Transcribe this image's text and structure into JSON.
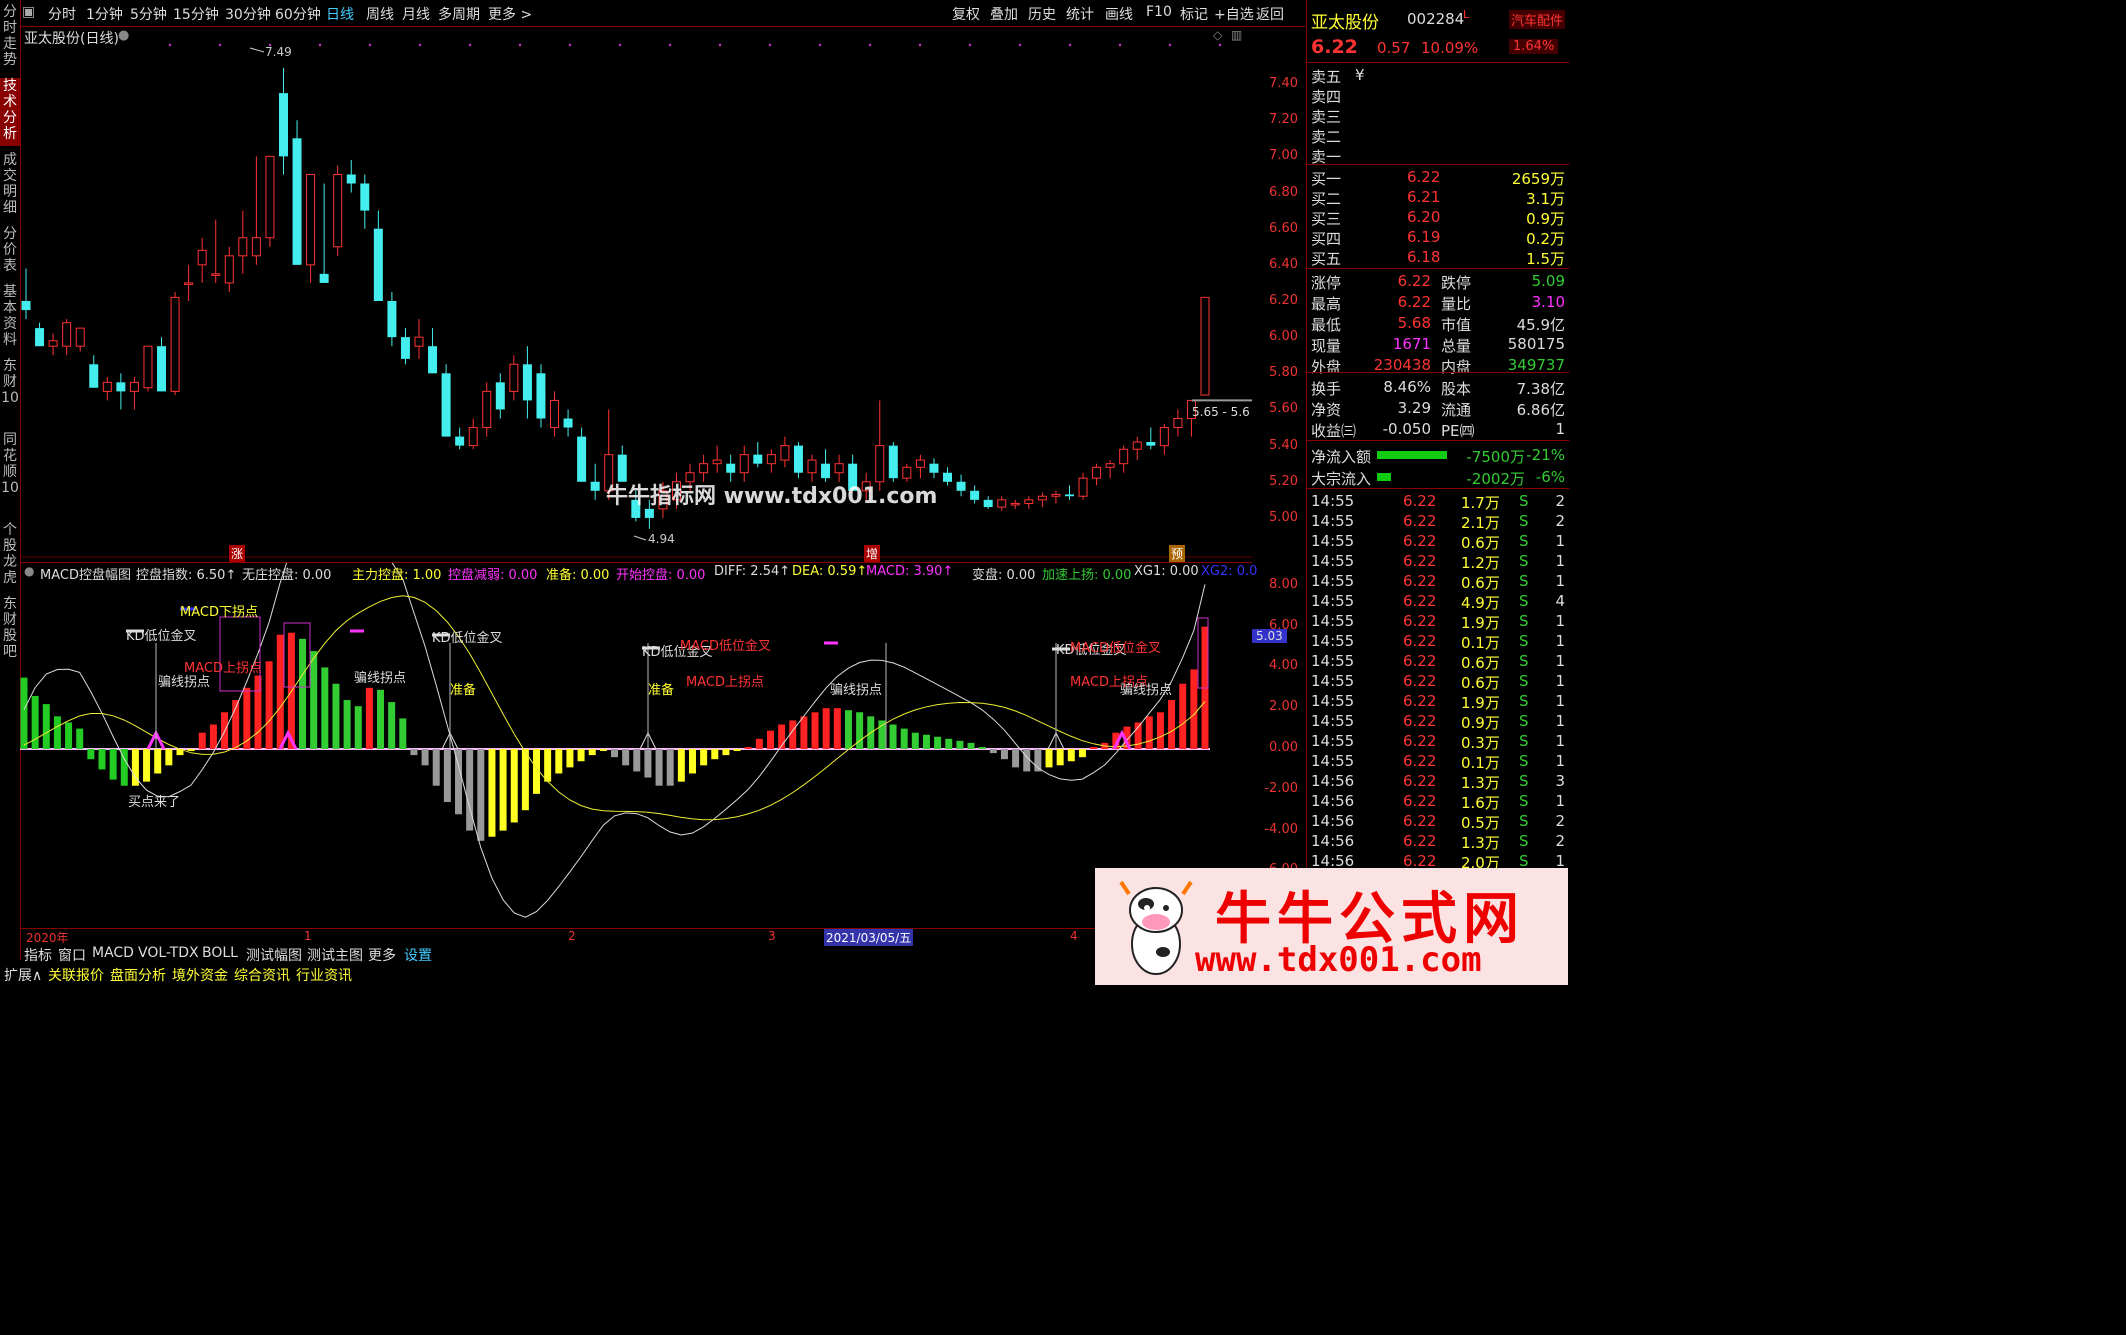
{
  "toolbar": {
    "periods": [
      "分时",
      "1分钟",
      "5分钟",
      "15分钟",
      "30分钟",
      "60分钟",
      "日线",
      "周线",
      "月线",
      "多周期",
      "更多 >"
    ],
    "selected": "日线",
    "actions": [
      "复权",
      "叠加",
      "历史",
      "统计",
      "画线",
      "F10",
      "标记",
      "+自选",
      "返回"
    ]
  },
  "left_tabs": [
    "分时走势",
    "技术分析",
    "成交明细",
    "分价表",
    "基本资料",
    "东财10",
    "同花顺10",
    "个股龙虎",
    "东财股吧"
  ],
  "left_tab_selected": "技术分析",
  "chart": {
    "title": "亚太股份(日线)",
    "high_label": "7.49",
    "low_label": "4.94",
    "price_axis": [
      "7.40",
      "7.20",
      "7.00",
      "6.80",
      "6.60",
      "6.40",
      "6.20",
      "6.00",
      "5.80",
      "5.60",
      "5.40",
      "5.20",
      "5.00"
    ],
    "price_tag": "5.65 - 5.6",
    "markers": [
      "涨",
      "增",
      "预"
    ],
    "watermark": "牛牛指标网 www.tdx001.com"
  },
  "indicator": {
    "name": "MACD控盘幅图",
    "fields": [
      {
        "label": "控盘指数: 6.50↑",
        "color": "#ddd"
      },
      {
        "label": "无庄控盘: 0.00",
        "color": "#ddd"
      },
      {
        "label": "主力控盘: 1.00",
        "color": "#ff3"
      },
      {
        "label": "控盘减弱: 0.00",
        "color": "#f3f"
      },
      {
        "label": "准备: 0.00",
        "color": "#ff3"
      },
      {
        "label": "开始控盘: 0.00",
        "color": "#f3f"
      },
      {
        "label": "DIFF: 2.54↑",
        "color": "#ddd"
      },
      {
        "label": "DEA: 0.59↑",
        "color": "#ff3"
      },
      {
        "label": "MACD: 3.90↑",
        "color": "#f3f"
      },
      {
        "label": "变盘: 0.00",
        "color": "#ddd"
      },
      {
        "label": "加速上扬: 0.00",
        "color": "#3c3"
      },
      {
        "label": "XG1: 0.00",
        "color": "#ddd"
      },
      {
        "label": "XG2: 0.0",
        "color": "#33f"
      }
    ],
    "axis": [
      "8.00",
      "6.00",
      "4.00",
      "2.00",
      "0.00",
      "-2.00",
      "-4.00",
      "-6.00"
    ],
    "value_tag": "5.03",
    "annotations": [
      {
        "text": "MACD下拐点",
        "color": "#ff3"
      },
      {
        "text": "KD低位金叉",
        "color": "#ddd"
      },
      {
        "text": "MACD上拐点",
        "color": "#f33"
      },
      {
        "text": "骗线拐点",
        "color": "#ddd"
      },
      {
        "text": "买点来了",
        "color": "#ddd"
      },
      {
        "text": "骗线拐点",
        "color": "#ddd"
      },
      {
        "text": "KD低位金叉",
        "color": "#ddd"
      },
      {
        "text": "准备",
        "color": "#ff3"
      },
      {
        "text": "KD低位金叉",
        "color": "#ddd"
      },
      {
        "text": "MACD低位金叉",
        "color": "#f33"
      },
      {
        "text": "准备",
        "color": "#ff3"
      },
      {
        "text": "MACD上拐点",
        "color": "#f33"
      },
      {
        "text": "骗线拐点",
        "color": "#ddd"
      },
      {
        "text": "KD低位金叉",
        "color": "#ddd"
      },
      {
        "text": "MACD低位金叉",
        "color": "#f33"
      },
      {
        "text": "MACD上拐点",
        "color": "#f33"
      },
      {
        "text": "骗线拐点",
        "color": "#ddd"
      }
    ]
  },
  "time_axis": [
    "2020年",
    "1",
    "2",
    "3",
    "2021/03/05/五",
    "4"
  ],
  "bottom_tabs": [
    "指标",
    "窗口",
    "MACD",
    "VOL-TDX",
    "BOLL",
    "测试幅图",
    "测试主图",
    "更多",
    "设置"
  ],
  "bottom_tabs2": [
    "扩展∧",
    "关联报价",
    "盘面分析",
    "境外资金",
    "综合资讯",
    "行业资讯"
  ],
  "quote": {
    "name": "亚太股份",
    "code": "002284",
    "flag": "L",
    "sector": "汽车配件",
    "sector_change": "1.64%",
    "price": "6.22",
    "change": "0.57",
    "change_pct": "10.09%",
    "asks": [
      {
        "label": "卖五",
        "price": "¥",
        "vol": ""
      },
      {
        "label": "卖四",
        "price": "",
        "vol": ""
      },
      {
        "label": "卖三",
        "price": "",
        "vol": ""
      },
      {
        "label": "卖二",
        "price": "",
        "vol": ""
      },
      {
        "label": "卖一",
        "price": "",
        "vol": ""
      }
    ],
    "bids": [
      {
        "label": "买一",
        "price": "6.22",
        "vol": "2659万"
      },
      {
        "label": "买二",
        "price": "6.21",
        "vol": "3.1万"
      },
      {
        "label": "买三",
        "price": "6.20",
        "vol": "0.9万"
      },
      {
        "label": "买四",
        "price": "6.19",
        "vol": "0.2万"
      },
      {
        "label": "买五",
        "price": "6.18",
        "vol": "1.5万"
      }
    ],
    "stats": [
      {
        "l1": "涨停",
        "v1": "6.22",
        "l2": "跌停",
        "v2": "5.09",
        "c1": "#f33",
        "c2": "#3c3"
      },
      {
        "l1": "最高",
        "v1": "6.22",
        "l2": "量比",
        "v2": "3.10",
        "c1": "#f33",
        "c2": "#f3f"
      },
      {
        "l1": "最低",
        "v1": "5.68",
        "l2": "市值",
        "v2": "45.9亿",
        "c1": "#f33",
        "c2": "#ddd"
      },
      {
        "l1": "现量",
        "v1": "1671",
        "l2": "总量",
        "v2": "580175",
        "c1": "#f3f",
        "c2": "#ddd"
      },
      {
        "l1": "外盘",
        "v1": "230438",
        "l2": "内盘",
        "v2": "349737",
        "c1": "#f33",
        "c2": "#3c3"
      }
    ],
    "stats2": [
      {
        "l1": "换手",
        "v1": "8.46%",
        "l2": "股本",
        "v2": "7.38亿"
      },
      {
        "l1": "净资",
        "v1": "3.29",
        "l2": "流通",
        "v2": "6.86亿"
      },
      {
        "l1": "收益㈢",
        "v1": "-0.050",
        "l2": "PE㈣",
        "v2": "1"
      }
    ],
    "flows": [
      {
        "label": "净流入额",
        "value": "-7500万",
        "pct": "-21%"
      },
      {
        "label": "大宗流入",
        "value": "-2002万",
        "pct": "-6%"
      }
    ],
    "ticks": [
      {
        "t": "14:55",
        "p": "6.22",
        "v": "1.7万",
        "s": "S",
        "n": "2"
      },
      {
        "t": "14:55",
        "p": "6.22",
        "v": "2.1万",
        "s": "S",
        "n": "2"
      },
      {
        "t": "14:55",
        "p": "6.22",
        "v": "0.6万",
        "s": "S",
        "n": "1"
      },
      {
        "t": "14:55",
        "p": "6.22",
        "v": "1.2万",
        "s": "S",
        "n": "1"
      },
      {
        "t": "14:55",
        "p": "6.22",
        "v": "0.6万",
        "s": "S",
        "n": "1"
      },
      {
        "t": "14:55",
        "p": "6.22",
        "v": "4.9万",
        "s": "S",
        "n": "4"
      },
      {
        "t": "14:55",
        "p": "6.22",
        "v": "1.9万",
        "s": "S",
        "n": "1"
      },
      {
        "t": "14:55",
        "p": "6.22",
        "v": "0.1万",
        "s": "S",
        "n": "1"
      },
      {
        "t": "14:55",
        "p": "6.22",
        "v": "0.6万",
        "s": "S",
        "n": "1"
      },
      {
        "t": "14:55",
        "p": "6.22",
        "v": "0.6万",
        "s": "S",
        "n": "1"
      },
      {
        "t": "14:55",
        "p": "6.22",
        "v": "1.9万",
        "s": "S",
        "n": "1"
      },
      {
        "t": "14:55",
        "p": "6.22",
        "v": "0.9万",
        "s": "S",
        "n": "1"
      },
      {
        "t": "14:55",
        "p": "6.22",
        "v": "0.3万",
        "s": "S",
        "n": "1"
      },
      {
        "t": "14:55",
        "p": "6.22",
        "v": "0.1万",
        "s": "S",
        "n": "1"
      },
      {
        "t": "14:56",
        "p": "6.22",
        "v": "1.3万",
        "s": "S",
        "n": "3"
      },
      {
        "t": "14:56",
        "p": "6.22",
        "v": "1.6万",
        "s": "S",
        "n": "1"
      },
      {
        "t": "14:56",
        "p": "6.22",
        "v": "0.5万",
        "s": "S",
        "n": "2"
      },
      {
        "t": "14:56",
        "p": "6.22",
        "v": "1.3万",
        "s": "S",
        "n": "2"
      },
      {
        "t": "14:56",
        "p": "6.22",
        "v": "2.0万",
        "s": "S",
        "n": "1"
      }
    ]
  },
  "brand": {
    "title": "牛牛公式网",
    "url": "www.tdx001.com"
  },
  "chart_data": {
    "type": "candlestick",
    "ylim": [
      4.9,
      7.5
    ],
    "candles": [
      [
        6.2,
        6.38,
        6.1,
        6.15
      ],
      [
        6.05,
        6.08,
        5.95,
        5.95
      ],
      [
        5.95,
        6.02,
        5.9,
        5.98
      ],
      [
        5.95,
        6.1,
        5.9,
        6.08
      ],
      [
        5.95,
        6.05,
        5.92,
        6.05
      ],
      [
        5.85,
        5.9,
        5.72,
        5.72
      ],
      [
        5.7,
        5.78,
        5.65,
        5.75
      ],
      [
        5.75,
        5.8,
        5.6,
        5.7
      ],
      [
        5.7,
        5.78,
        5.6,
        5.75
      ],
      [
        5.72,
        5.95,
        5.7,
        5.95
      ],
      [
        5.95,
        6.0,
        5.7,
        5.7
      ],
      [
        5.7,
        6.25,
        5.68,
        6.22
      ],
      [
        6.3,
        6.4,
        6.2,
        6.3
      ],
      [
        6.4,
        6.55,
        6.3,
        6.48
      ],
      [
        6.35,
        6.65,
        6.3,
        6.35
      ],
      [
        6.3,
        6.5,
        6.25,
        6.45
      ],
      [
        6.45,
        6.7,
        6.35,
        6.55
      ],
      [
        6.45,
        7.0,
        6.4,
        6.55
      ],
      [
        6.55,
        7.0,
        6.5,
        7.0
      ],
      [
        7.35,
        7.49,
        6.9,
        7.0
      ],
      [
        7.1,
        7.2,
        6.4,
        6.4
      ],
      [
        6.4,
        6.9,
        6.3,
        6.9
      ],
      [
        6.35,
        6.85,
        6.3,
        6.3
      ],
      [
        6.5,
        6.95,
        6.45,
        6.9
      ],
      [
        6.9,
        6.98,
        6.8,
        6.85
      ],
      [
        6.85,
        6.9,
        6.6,
        6.7
      ],
      [
        6.6,
        6.7,
        6.25,
        6.2
      ],
      [
        6.2,
        6.25,
        5.95,
        6.0
      ],
      [
        6.0,
        6.05,
        5.85,
        5.88
      ],
      [
        5.95,
        6.1,
        5.88,
        6.0
      ],
      [
        5.95,
        6.05,
        5.8,
        5.8
      ],
      [
        5.8,
        5.85,
        5.45,
        5.45
      ],
      [
        5.45,
        5.5,
        5.38,
        5.4
      ],
      [
        5.4,
        5.55,
        5.38,
        5.5
      ],
      [
        5.5,
        5.75,
        5.45,
        5.7
      ],
      [
        5.75,
        5.8,
        5.55,
        5.6
      ],
      [
        5.7,
        5.9,
        5.65,
        5.85
      ],
      [
        5.85,
        5.95,
        5.55,
        5.65
      ],
      [
        5.8,
        5.85,
        5.5,
        5.55
      ],
      [
        5.5,
        5.7,
        5.45,
        5.65
      ],
      [
        5.55,
        5.6,
        5.45,
        5.5
      ],
      [
        5.45,
        5.5,
        5.2,
        5.2
      ],
      [
        5.2,
        5.3,
        5.1,
        5.15
      ],
      [
        5.15,
        5.6,
        5.1,
        5.35
      ],
      [
        5.35,
        5.4,
        5.2,
        5.2
      ],
      [
        5.1,
        5.15,
        4.98,
        5.0
      ],
      [
        5.05,
        5.1,
        4.94,
        5.0
      ],
      [
        5.05,
        5.2,
        5.0,
        5.15
      ],
      [
        5.1,
        5.25,
        5.05,
        5.2
      ],
      [
        5.2,
        5.3,
        5.15,
        5.25
      ],
      [
        5.25,
        5.35,
        5.2,
        5.3
      ],
      [
        5.3,
        5.4,
        5.25,
        5.32
      ],
      [
        5.3,
        5.35,
        5.2,
        5.25
      ],
      [
        5.25,
        5.4,
        5.2,
        5.35
      ],
      [
        5.35,
        5.42,
        5.28,
        5.3
      ],
      [
        5.3,
        5.38,
        5.25,
        5.35
      ],
      [
        5.32,
        5.45,
        5.28,
        5.4
      ],
      [
        5.4,
        5.42,
        5.22,
        5.25
      ],
      [
        5.25,
        5.35,
        5.2,
        5.32
      ],
      [
        5.3,
        5.38,
        5.2,
        5.22
      ],
      [
        5.25,
        5.35,
        5.2,
        5.3
      ],
      [
        5.3,
        5.35,
        5.15,
        5.15
      ],
      [
        5.15,
        5.25,
        5.1,
        5.2
      ],
      [
        5.2,
        5.65,
        5.15,
        5.4
      ],
      [
        5.4,
        5.42,
        5.2,
        5.22
      ],
      [
        5.22,
        5.3,
        5.2,
        5.28
      ],
      [
        5.28,
        5.35,
        5.22,
        5.32
      ],
      [
        5.3,
        5.33,
        5.22,
        5.25
      ],
      [
        5.25,
        5.28,
        5.18,
        5.2
      ],
      [
        5.2,
        5.24,
        5.12,
        5.15
      ],
      [
        5.15,
        5.18,
        5.08,
        5.1
      ],
      [
        5.1,
        5.12,
        5.05,
        5.06
      ],
      [
        5.06,
        5.12,
        5.04,
        5.1
      ],
      [
        5.08,
        5.1,
        5.05,
        5.08
      ],
      [
        5.08,
        5.12,
        5.05,
        5.1
      ],
      [
        5.1,
        5.14,
        5.06,
        5.12
      ],
      [
        5.12,
        5.15,
        5.08,
        5.13
      ],
      [
        5.13,
        5.18,
        5.1,
        5.12
      ],
      [
        5.12,
        5.25,
        5.1,
        5.22
      ],
      [
        5.22,
        5.3,
        5.18,
        5.28
      ],
      [
        5.28,
        5.32,
        5.22,
        5.3
      ],
      [
        5.3,
        5.4,
        5.25,
        5.38
      ],
      [
        5.38,
        5.45,
        5.32,
        5.42
      ],
      [
        5.42,
        5.5,
        5.38,
        5.4
      ],
      [
        5.4,
        5.52,
        5.35,
        5.5
      ],
      [
        5.5,
        5.6,
        5.45,
        5.55
      ],
      [
        5.55,
        5.65,
        5.45,
        5.65
      ],
      [
        5.68,
        6.22,
        5.68,
        6.22
      ]
    ],
    "macd_hist": [
      3.5,
      2.6,
      2.2,
      1.6,
      1.3,
      1.0,
      -0.5,
      -1.0,
      -1.5,
      -1.8,
      -1.8,
      -1.6,
      -1.2,
      -0.8,
      -0.3,
      -0.1,
      0.8,
      1.2,
      1.8,
      2.4,
      3.0,
      3.6,
      4.3,
      5.6,
      5.7,
      5.4,
      4.8,
      4.0,
      3.2,
      2.4,
      2.1,
      3.0,
      2.9,
      2.3,
      1.5,
      -0.3,
      -0.8,
      -1.8,
      -2.6,
      -3.2,
      -4.0,
      -4.5,
      -4.3,
      -4.0,
      -3.6,
      -3.0,
      -2.2,
      -1.6,
      -1.2,
      -0.9,
      -0.6,
      -0.3,
      -0.1,
      -0.4,
      -0.8,
      -1.1,
      -1.4,
      -1.8,
      -1.8,
      -1.6,
      -1.2,
      -0.8,
      -0.5,
      -0.3,
      -0.1,
      0.1,
      0.5,
      0.9,
      1.2,
      1.4,
      1.6,
      1.8,
      2.0,
      2.0,
      1.9,
      1.8,
      1.6,
      1.4,
      1.2,
      1.0,
      0.8,
      0.7,
      0.6,
      0.5,
      0.4,
      0.3,
      0.1,
      -0.2,
      -0.5,
      -0.9,
      -1.1,
      -1.1,
      -0.9,
      -0.8,
      -0.6,
      -0.4,
      0.1,
      0.3,
      0.8,
      1.1,
      1.3,
      1.6,
      1.8,
      2.4,
      3.2,
      3.9,
      6.0
    ]
  }
}
